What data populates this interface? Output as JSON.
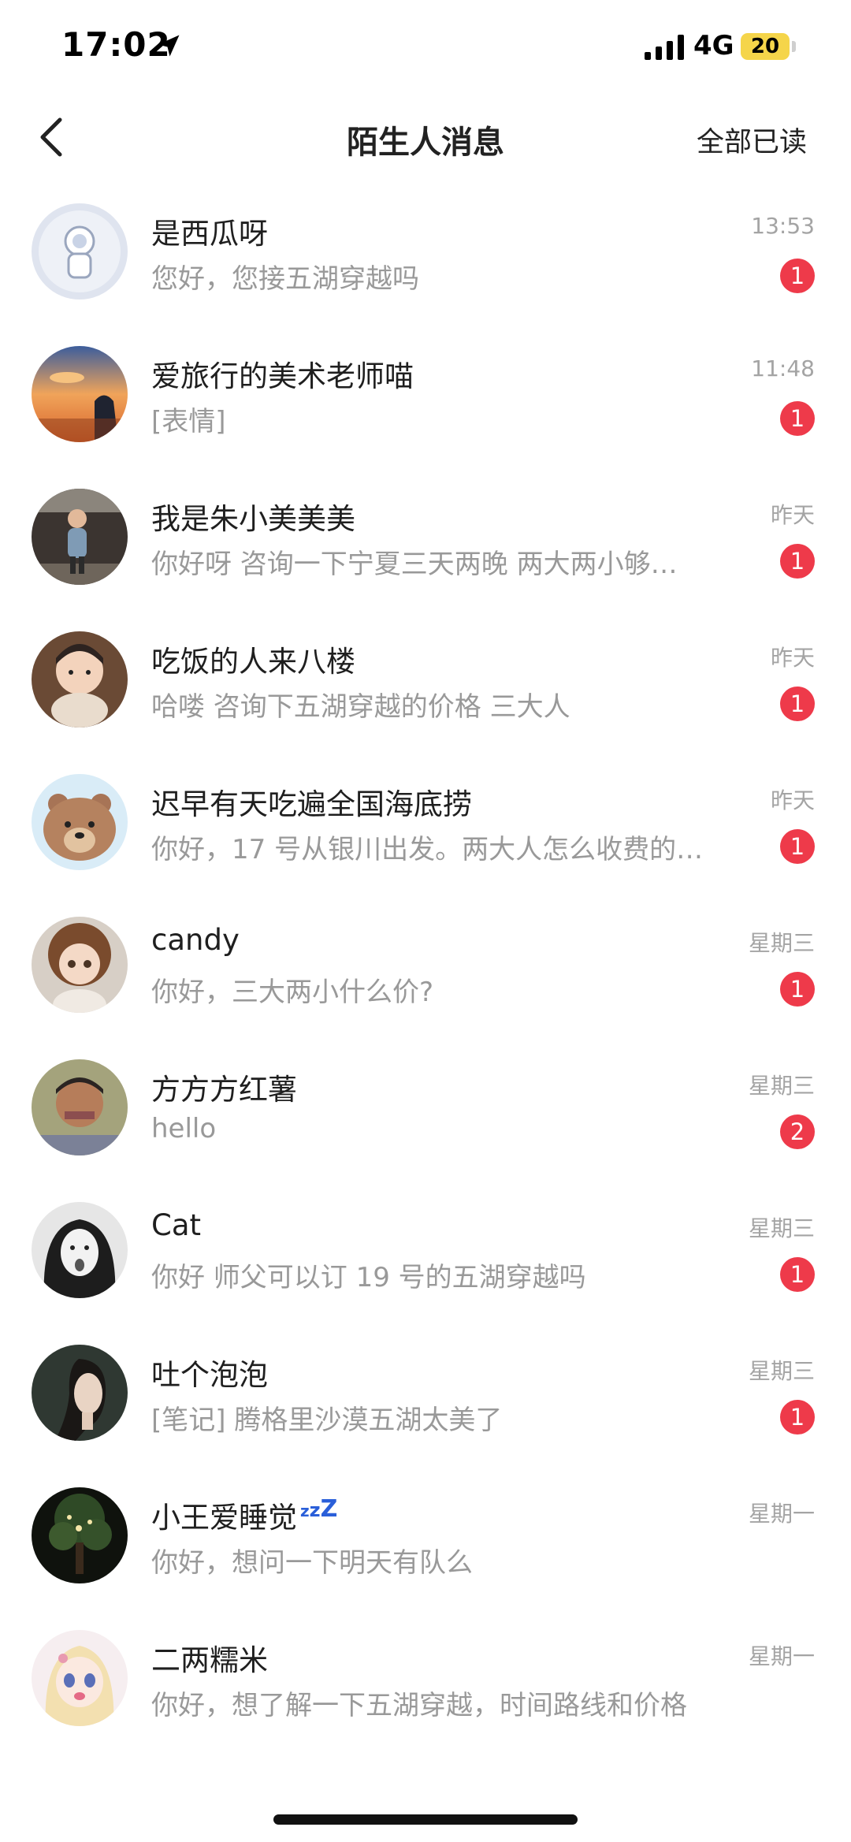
{
  "status_bar": {
    "time": "17:02",
    "network": "4G",
    "battery": "20"
  },
  "header": {
    "title": "陌生人消息",
    "mark_all_read": "全部已读"
  },
  "messages": [
    {
      "name": "是西瓜呀",
      "preview": "您好，您接五湖穿越吗",
      "time": "13:53",
      "unread": "1"
    },
    {
      "name": "爱旅行的美术老师喵",
      "preview": "[表情]",
      "time": "11:48",
      "unread": "1"
    },
    {
      "name": "我是朱小美美美",
      "preview": "你好呀 咨询一下宁夏三天两晚 两大两小够…",
      "time": "昨天",
      "unread": "1"
    },
    {
      "name": "吃饭的人来八楼",
      "preview": "哈喽 咨询下五湖穿越的价格 三大人",
      "time": "昨天",
      "unread": "1"
    },
    {
      "name": "迟早有天吃遍全国海底捞",
      "preview": "你好，17 号从银川出发。两大人怎么收费的…",
      "time": "昨天",
      "unread": "1"
    },
    {
      "name": "candy",
      "preview": "你好，三大两小什么价?",
      "time": "星期三",
      "unread": "1"
    },
    {
      "name": "方方方红薯",
      "preview": "hello",
      "time": "星期三",
      "unread": "2"
    },
    {
      "name": "Cat",
      "preview": "你好 师父可以订 19 号的五湖穿越吗",
      "time": "星期三",
      "unread": "1"
    },
    {
      "name": "吐个泡泡",
      "preview": "[笔记] 腾格里沙漠五湖太美了",
      "time": "星期三",
      "unread": "1"
    },
    {
      "name": "小王爱睡觉",
      "preview": "你好，想问一下明天有队么",
      "time": "星期一",
      "unread": ""
    },
    {
      "name": "二两糯米",
      "preview": "你好，想了解一下五湖穿越，时间路线和价格",
      "time": "星期一",
      "unread": ""
    }
  ],
  "colors": {
    "badge": "#ee3a4a",
    "secondary_text": "#999999",
    "battery": "#f5d54a",
    "sleep_icon": "#2a5fd9"
  },
  "icons": {
    "back": "chevron-left-icon",
    "location": "location-arrow-icon",
    "signal": "cellular-signal-icon",
    "sleep": "zzz-sleep-icon"
  }
}
